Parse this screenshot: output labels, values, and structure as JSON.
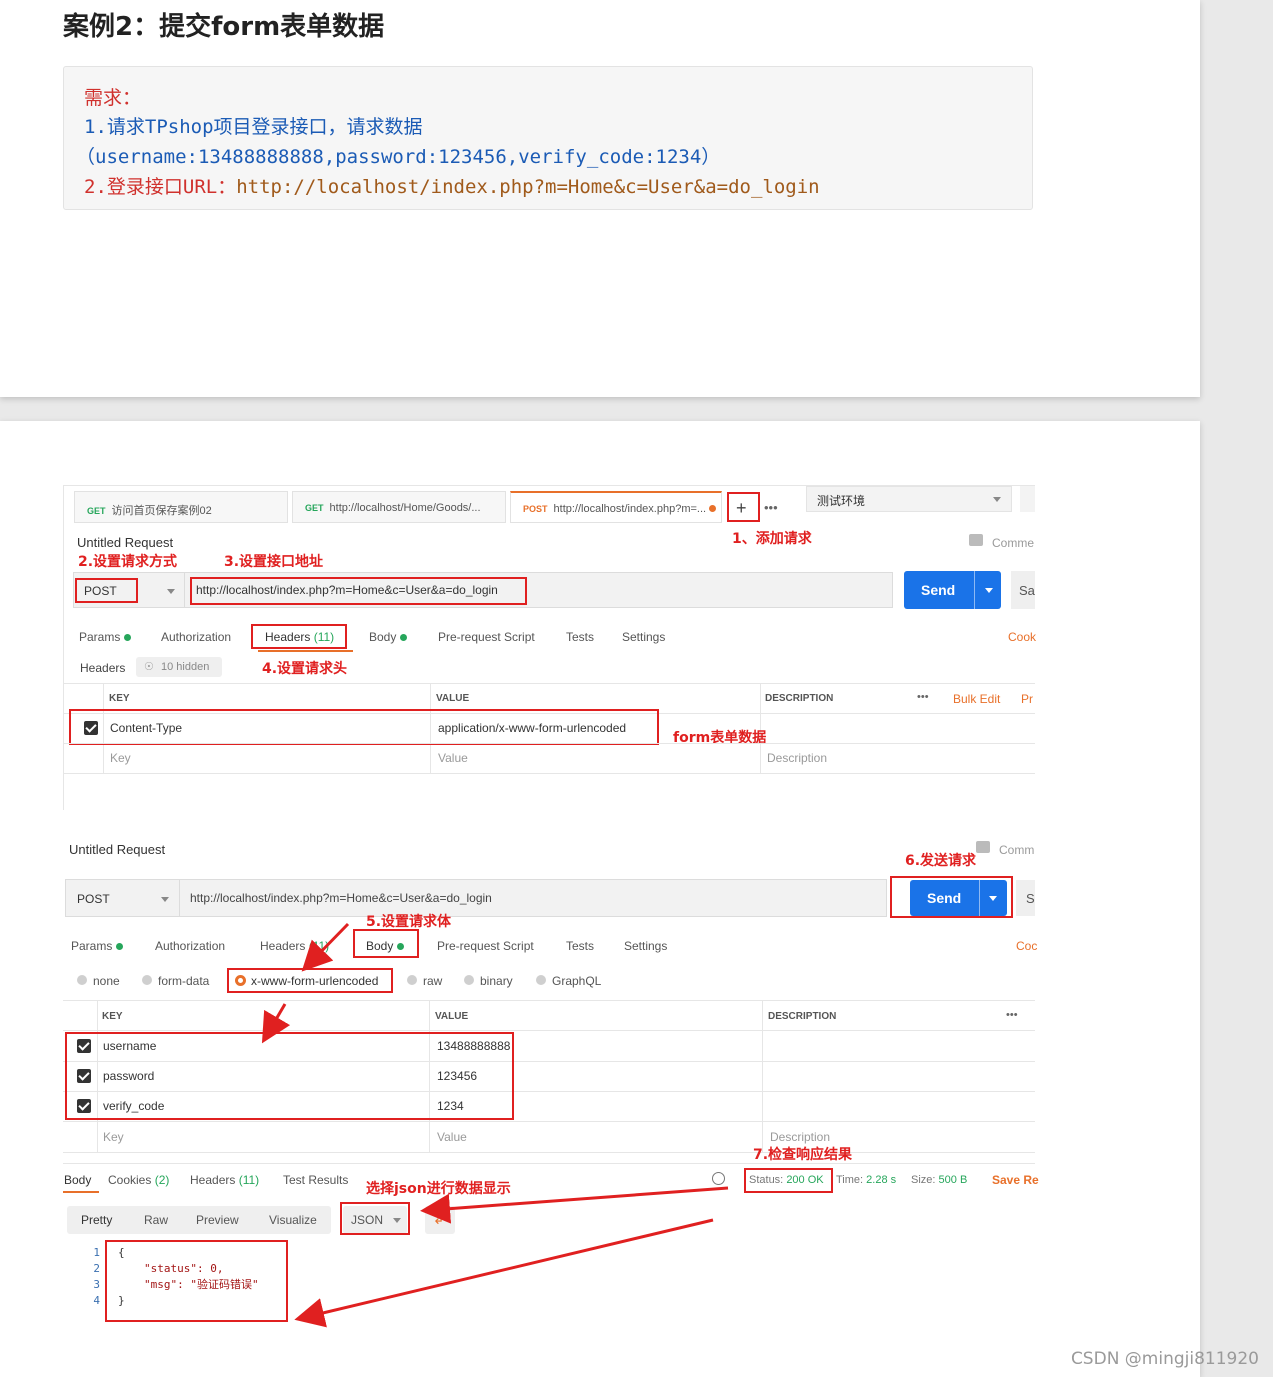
{
  "article": {
    "title": "案例2：提交form表单数据",
    "requirement": {
      "heading": "需求：",
      "line1": "1.请求TPshop项目登录接口，请求数据",
      "line2": "（username:13488888888,password:123456,verify_code:1234）",
      "line3_prefix": "2.登录接口URL：",
      "line3_url": "http://localhost/index.php?m=Home&c=User&a=do_login"
    }
  },
  "postman1": {
    "tabs": [
      {
        "method": "GET",
        "label": "访问首页保存案例02"
      },
      {
        "method": "GET",
        "label": "http://localhost/Home/Goods/..."
      },
      {
        "method": "POST",
        "label": "http://localhost/index.php?m=..."
      }
    ],
    "add_tab": "+",
    "more": "•••",
    "environment": "测试环境",
    "request_name": "Untitled Request",
    "comments": "Comme",
    "method": "POST",
    "url": "http://localhost/index.php?m=Home&c=User&a=do_login",
    "send": "Send",
    "save": "Sa",
    "subtabs": {
      "params": "Params",
      "authorization": "Authorization",
      "headers": "Headers",
      "headers_count": "(11)",
      "body": "Body",
      "prerequest": "Pre-request Script",
      "tests": "Tests",
      "settings": "Settings",
      "cookies": "Cook"
    },
    "headers_label": "Headers",
    "hidden": "10 hidden",
    "table": {
      "key": "KEY",
      "value": "VALUE",
      "description": "DESCRIPTION",
      "bulk_edit": "Bulk Edit",
      "presets": "Pr",
      "more": "•••"
    },
    "rows": [
      {
        "key": "Content-Type",
        "value": "application/x-www-form-urlencoded"
      }
    ],
    "placeholder": {
      "key": "Key",
      "value": "Value",
      "description": "Description"
    }
  },
  "postman2": {
    "request_name": "Untitled Request",
    "comments": "Comm",
    "method": "POST",
    "url": "http://localhost/index.php?m=Home&c=User&a=do_login",
    "send": "Send",
    "save": "S",
    "subtabs": {
      "params": "Params",
      "authorization": "Authorization",
      "headers": "Headers",
      "headers_count": "(11)",
      "body": "Body",
      "prerequest": "Pre-request Script",
      "tests": "Tests",
      "settings": "Settings",
      "cookies": "Coc"
    },
    "body_types": [
      "none",
      "form-data",
      "x-www-form-urlencoded",
      "raw",
      "binary",
      "GraphQL"
    ],
    "table": {
      "key": "KEY",
      "value": "VALUE",
      "description": "DESCRIPTION",
      "more": "•••"
    },
    "rows": [
      {
        "key": "username",
        "value": "13488888888"
      },
      {
        "key": "password",
        "value": "123456"
      },
      {
        "key": "verify_code",
        "value": "1234"
      }
    ],
    "placeholder": {
      "key": "Key",
      "value": "Value",
      "description": "Description"
    },
    "response_tabs": {
      "body": "Body",
      "cookies": "Cookies",
      "cookies_count": "(2)",
      "headers": "Headers",
      "headers_count": "(11)",
      "test_results": "Test Results"
    },
    "status_label": "Status:",
    "status_value": "200 OK",
    "time_label": "Time:",
    "time_value": "2.28 s",
    "size_label": "Size:",
    "size_value": "500 B",
    "save_response": "Save Re",
    "view_modes": [
      "Pretty",
      "Raw",
      "Preview",
      "Visualize"
    ],
    "format": "JSON",
    "json_lines": [
      "{",
      "\"status\": 0,",
      "\"msg\": \"验证码错误\"",
      "}"
    ],
    "line_numbers": [
      "1",
      "2",
      "3",
      "4"
    ]
  },
  "annotations": {
    "add_request": "1、添加请求",
    "set_method": "2.设置请求方式",
    "set_url": "3.设置接口地址",
    "set_headers": "4.设置请求头",
    "form_data": "form表单数据",
    "set_body": "5.设置请求体",
    "send": "6.发送请求",
    "check_response": "7.检查响应结果",
    "select_json": "选择json进行数据显示"
  },
  "colors": {
    "annotation": "#e02020",
    "send_button": "#1a73e8",
    "accent": "#e8702a",
    "success": "#26a65b"
  },
  "watermark": "CSDN @mingji811920"
}
